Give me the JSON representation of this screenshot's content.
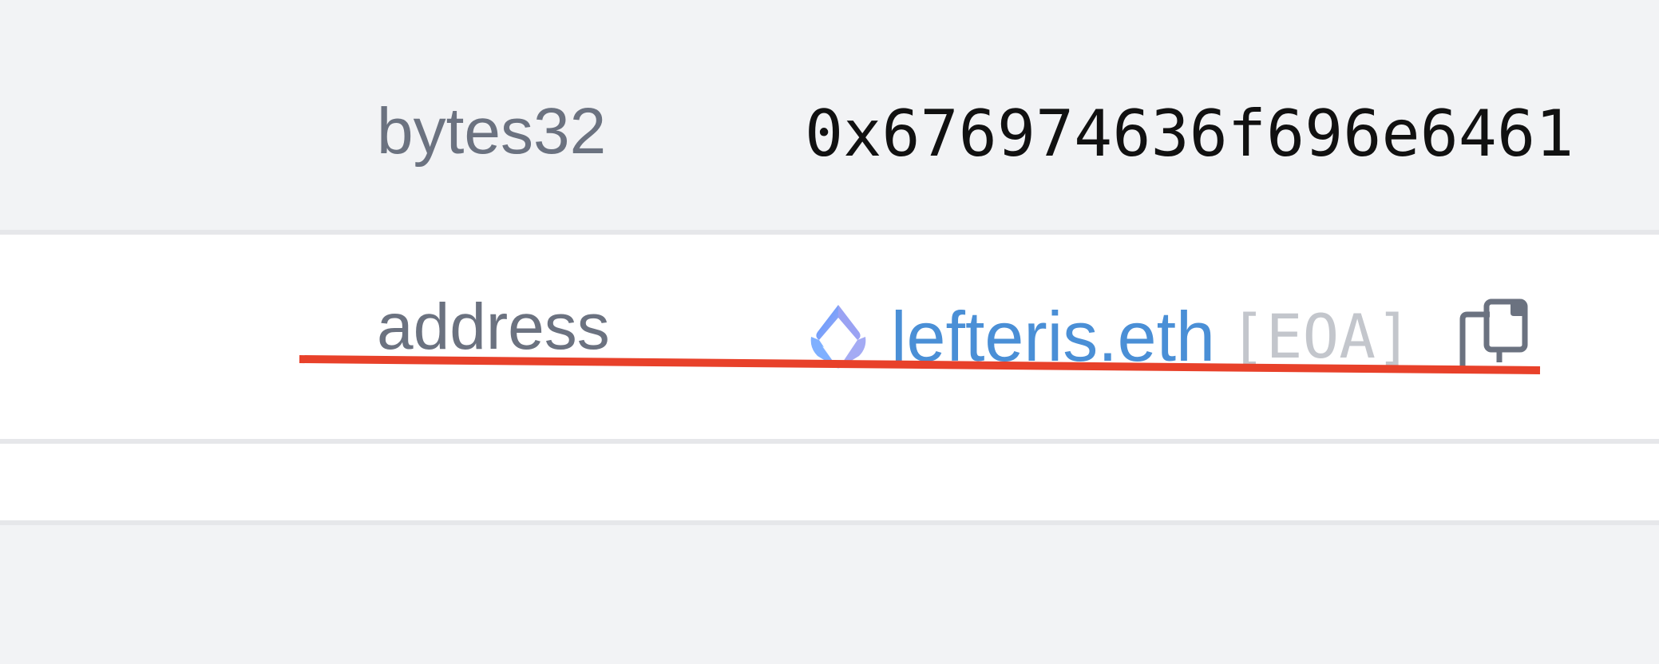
{
  "rows": {
    "bytes32": {
      "type": "bytes32",
      "value": "0x676974636f696e6461"
    },
    "address": {
      "type": "address",
      "ens_name": "lefteris.eth",
      "account_tag": "[EOA]",
      "ens_icon": "ens-logo-icon",
      "copy_icon": "copy-icon"
    }
  },
  "colors": {
    "background": "#f2f3f5",
    "row_white": "#ffffff",
    "divider": "#e6e7ea",
    "type_label": "#6b7280",
    "link": "#4a8fd6",
    "tag": "#c3c6cc",
    "annotation_line": "#e8412a"
  }
}
